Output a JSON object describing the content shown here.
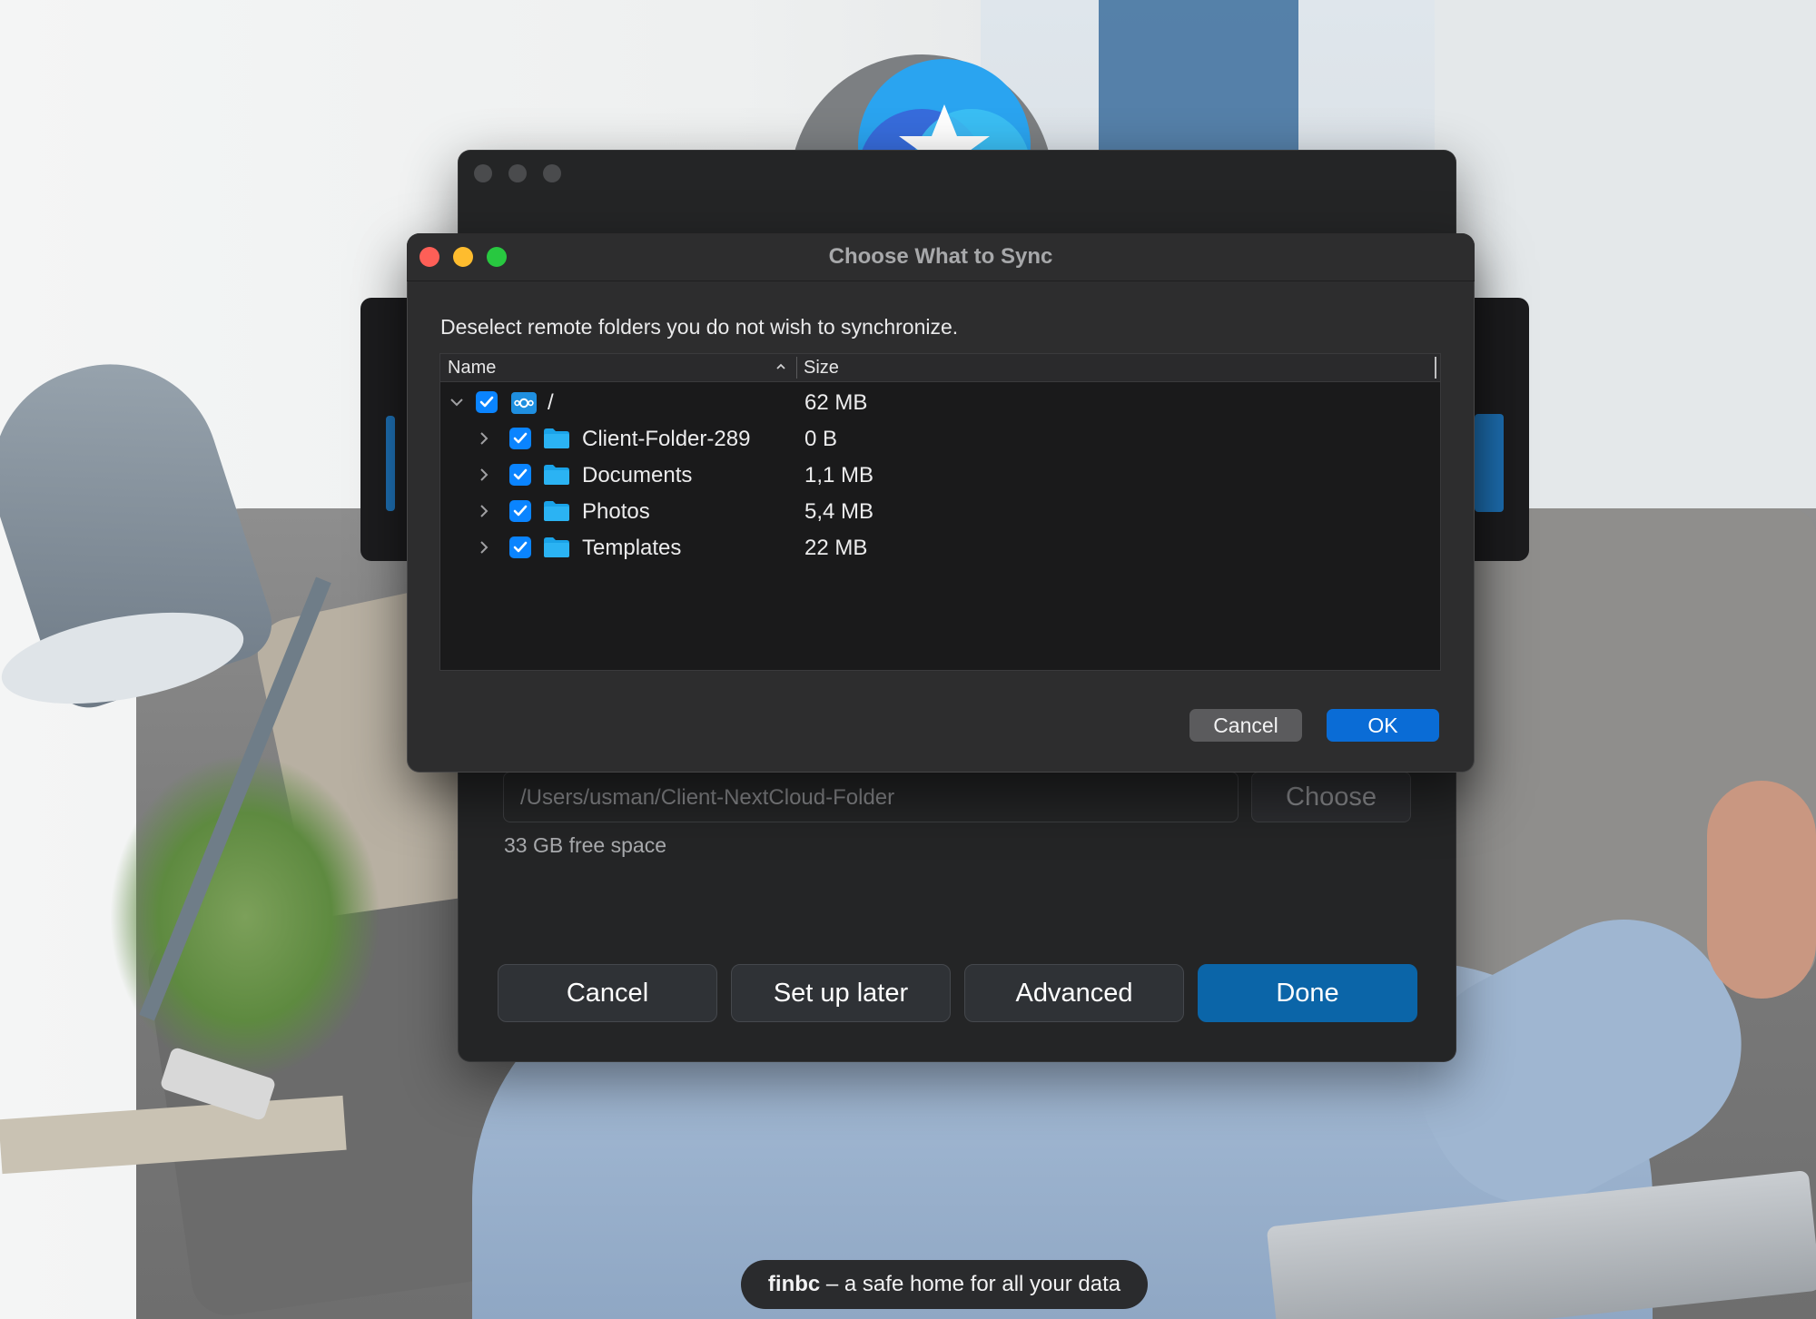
{
  "dialog": {
    "title": "Choose What to Sync",
    "instructions": "Deselect remote folders you do not wish to synchronize.",
    "columns": {
      "name": "Name",
      "size": "Size"
    },
    "root": {
      "name": "/",
      "size": "62 MB",
      "checked": true,
      "expanded": true
    },
    "folders": [
      {
        "name": "Client-Folder-289",
        "size": "0 B",
        "checked": true
      },
      {
        "name": "Documents",
        "size": "1,1 MB",
        "checked": true
      },
      {
        "name": "Photos",
        "size": "5,4 MB",
        "checked": true
      },
      {
        "name": "Templates",
        "size": "22 MB",
        "checked": true
      }
    ],
    "cancel_label": "Cancel",
    "ok_label": "OK"
  },
  "wizard": {
    "local_path": "/Users/usman/Client-NextCloud-Folder",
    "choose_label": "Choose",
    "free_space": "33 GB free space",
    "buttons": {
      "cancel": "Cancel",
      "setup_later": "Set up later",
      "advanced": "Advanced",
      "done": "Done"
    }
  },
  "caption": {
    "brand": "finbc",
    "tagline": " – a safe home for all your data"
  },
  "colors": {
    "accent": "#0a84ff",
    "done_button": "#0b65a8",
    "folder_icon": "#1aa3e8"
  },
  "icons": {
    "root_icon": "nextcloud-logo-icon",
    "folder_icon": "folder-icon",
    "expand_icon": "chevron-right-icon",
    "collapse_icon": "chevron-down-icon",
    "sort_icon": "sort-ascending-icon"
  }
}
